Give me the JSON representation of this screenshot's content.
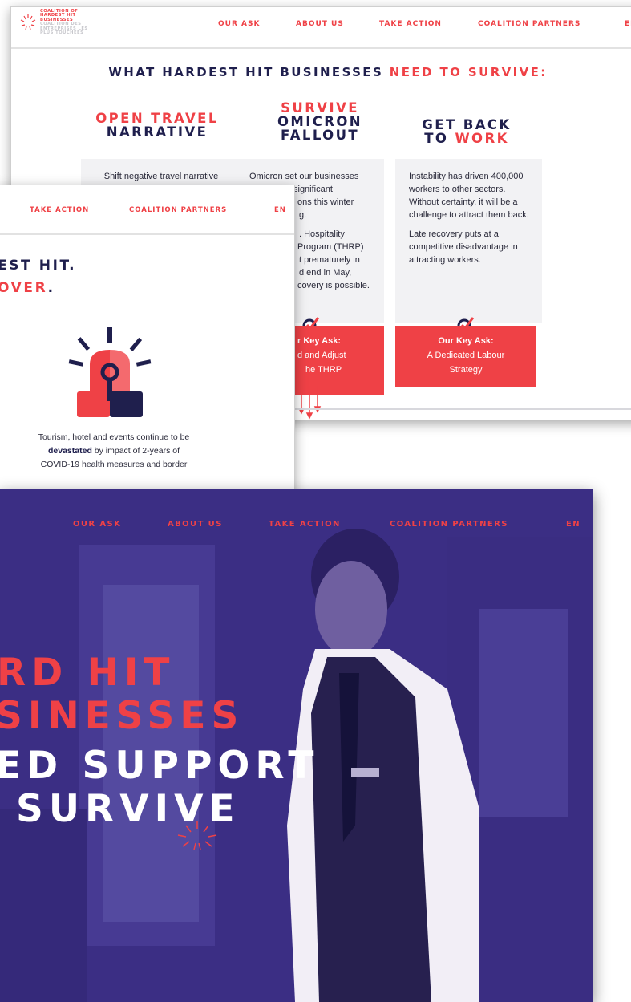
{
  "colors": {
    "accent": "#ef4146",
    "navy": "#1f1f4d",
    "hero_bg": "#3c2f86",
    "card_bg": "#f2f2f4"
  },
  "back_page": {
    "logo": {
      "lines_red": [
        "COALITION OF",
        "HARDEST HIT",
        "BUSINESSES"
      ],
      "lines_gray": [
        "COALITION DES",
        "ENTREPRISES LES",
        "PLUS TOUCHÉES"
      ]
    },
    "nav": [
      "OUR ASK",
      "ABOUT US",
      "TAKE ACTION",
      "COALITION PARTNERS",
      "EN"
    ],
    "heading": {
      "main": "WHAT HARDEST HIT BUSINESSES ",
      "accent": "NEED TO SURVIVE:"
    },
    "columns": [
      {
        "title_red": "OPEN TRAVEL",
        "title_dark": "NARRATIVE",
        "text": [
          "Shift negative travel narrative"
        ]
      },
      {
        "title_red": "SURVIVE",
        "title_dark": "OMICRON",
        "title_dark2": "FALLOUT",
        "text": [
          "Omicron set our businesses",
          "significant",
          "ons this winter",
          "g.",
          ". Hospitality",
          "Program (THRP)",
          "t prematurely in",
          "d end in May,",
          "covery is possible."
        ],
        "ask_label": "r Key Ask:",
        "ask_text": [
          "d and Adjust",
          "he THRP"
        ]
      },
      {
        "title_dark": "GET BACK",
        "title_dark2": "TO ",
        "title_red": "WORK",
        "text": [
          "Instability has driven 400,000 workers to other sectors. Without certainty, it will be a challenge to attract them back.",
          "Late recovery puts at a competitive disadvantage in attracting workers."
        ],
        "ask_label": "Our Key Ask:",
        "ask_text": [
          "A Dedicated Labour",
          "Strategy"
        ]
      }
    ]
  },
  "middle_page": {
    "nav": [
      "TAKE ACTION",
      "COALITION PARTNERS",
      "EN"
    ],
    "heading": {
      "line1": "EST HIT.",
      "line2_red": "OVER",
      "line2_end": "."
    },
    "icon": "siren-icon",
    "paragraph": {
      "before": "Tourism, hotel and events continue to be ",
      "bold": "devastated",
      "after": " by impact of 2-years of COVID-19 health measures and border"
    }
  },
  "front_page": {
    "nav": [
      "OUR ASK",
      "ABOUT US",
      "TAKE ACTION",
      "COALITION PARTNERS",
      "EN"
    ],
    "hero": [
      "RD HIT",
      "SINESSES",
      "ED SUPPORT",
      "SURVIVE"
    ]
  }
}
